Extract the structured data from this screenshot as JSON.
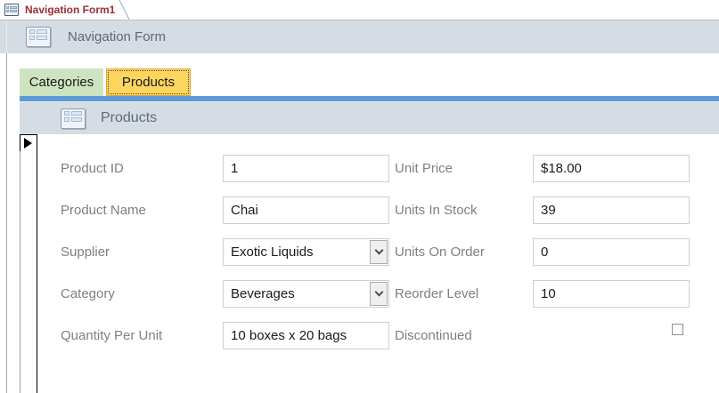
{
  "window": {
    "doc_tab_label": "Navigation Form1"
  },
  "nav_header": {
    "title": "Navigation Form",
    "icon": "form-window-icon"
  },
  "tabs": [
    {
      "label": "Categories",
      "active": false,
      "color": "#cee4c0"
    },
    {
      "label": "Products",
      "active": true,
      "color": "#fcd65f"
    }
  ],
  "subform": {
    "title": "Products",
    "icon": "form-window-icon"
  },
  "form": {
    "columns": [
      {
        "id": "left",
        "fields": [
          {
            "label": "Product ID",
            "value": "1",
            "type": "text"
          },
          {
            "label": "Product Name",
            "value": "Chai",
            "type": "text"
          },
          {
            "label": "Supplier",
            "value": "Exotic Liquids",
            "type": "combo"
          },
          {
            "label": "Category",
            "value": "Beverages",
            "type": "combo"
          },
          {
            "label": "Quantity Per Unit",
            "value": "10 boxes x 20 bags",
            "type": "text"
          }
        ]
      },
      {
        "id": "right",
        "fields": [
          {
            "label": "Unit Price",
            "value": "$18.00",
            "type": "text"
          },
          {
            "label": "Units In Stock",
            "value": "39",
            "type": "text"
          },
          {
            "label": "Units On Order",
            "value": "0",
            "type": "text"
          },
          {
            "label": "Reorder Level",
            "value": "10",
            "type": "text"
          },
          {
            "label": "Discontinued",
            "value": false,
            "type": "checkbox"
          }
        ]
      }
    ]
  },
  "colors": {
    "header_band": "#d6dce3",
    "accent_blue_bar": "#5b9bd5",
    "tab_green": "#cee4c0",
    "tab_gold": "#fcd65f",
    "doc_tab_text": "#9a2d39",
    "label_gray": "#7f7f7f",
    "header_text": "#5d6b7c"
  }
}
